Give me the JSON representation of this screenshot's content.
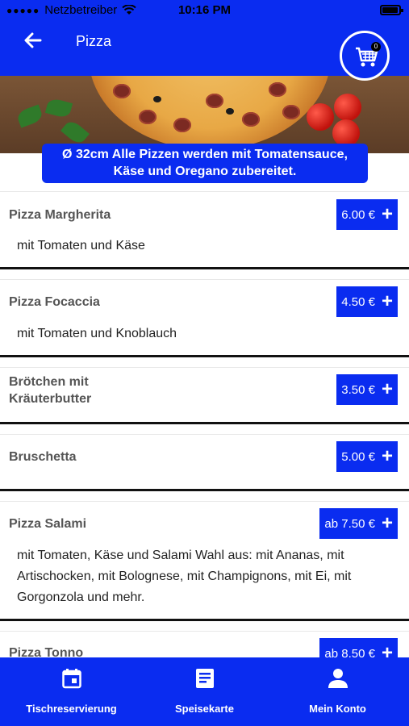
{
  "status_bar": {
    "carrier": "Netzbetreiber",
    "time": "10:16 PM"
  },
  "header": {
    "title": "Pizza",
    "cart_count": "0"
  },
  "info_banner": {
    "line1": "Ø 32cm Alle Pizzen werden mit Tomatensauce,",
    "line2": "Käse und Oregano zubereitet."
  },
  "menu_items": [
    {
      "name": "Pizza Margherita",
      "name_line2": "",
      "price": "6.00 €",
      "description": "mit Tomaten und Käse"
    },
    {
      "name": "Pizza Focaccia",
      "name_line2": "",
      "price": "4.50 €",
      "description": "mit Tomaten und Knoblauch"
    },
    {
      "name": "Brötchen mit",
      "name_line2": "Kräuterbutter",
      "price": "3.50 €",
      "description": ""
    },
    {
      "name": "Bruschetta",
      "name_line2": "",
      "price": "5.00 €",
      "description": ""
    },
    {
      "name": "Pizza Salami",
      "name_line2": "",
      "price": "ab 7.50 €",
      "description": "mit Tomaten, Käse und Salami Wahl aus: mit Ananas, mit Artischocken, mit Bolognese, mit Champignons, mit Ei, mit Gorgonzola und mehr."
    },
    {
      "name": "Pizza Tonno",
      "name_line2": "",
      "price": "ab 8.50 €",
      "description": ""
    }
  ],
  "bottom_nav": [
    {
      "label": "Tischreservierung",
      "icon": "calendar-icon"
    },
    {
      "label": "Speisekarte",
      "icon": "menu-document-icon"
    },
    {
      "label": "Mein Konto",
      "icon": "person-icon"
    }
  ],
  "colors": {
    "accent": "#0a2cf0",
    "text": "#222222",
    "name": "#555555"
  }
}
